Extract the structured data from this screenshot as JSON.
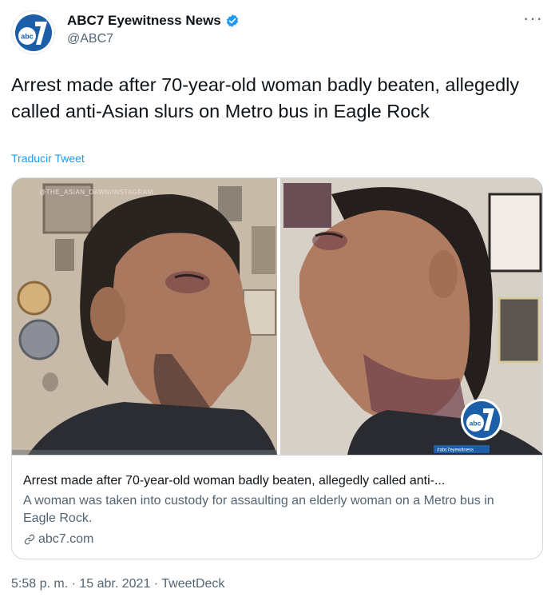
{
  "account": {
    "display_name": "ABC7 Eyewitness News",
    "handle": "@ABC7",
    "avatar_icon": "abc7-logo",
    "verified_icon": "verified-badge-icon",
    "verified_color": "#1d9bf0"
  },
  "more_icon": "more-options-icon",
  "tweet": {
    "text": "Arrest made after 70-year-old woman badly beaten, allegedly called anti-Asian slurs on Metro bus in Eagle Rock",
    "translate_label": "Traducir Tweet"
  },
  "card": {
    "image_watermark": "@THE_ASIAN_DAWN/INSTAGRAM",
    "image_hashtag": "#abc7eyewitness",
    "title": "Arrest made after 70-year-old woman badly beaten, allegedly called anti-...",
    "description": "A woman was taken into custody for assaulting an elderly woman on a Metro bus in Eagle Rock.",
    "domain": "abc7.com",
    "link_icon": "link-icon"
  },
  "timestamp": "5:58 p. m. · 15 abr. 2021 · TweetDeck",
  "colors": {
    "accent": "#1d9bf0",
    "text": "#0f1419",
    "secondary": "#536471",
    "border": "#cfd9de"
  }
}
